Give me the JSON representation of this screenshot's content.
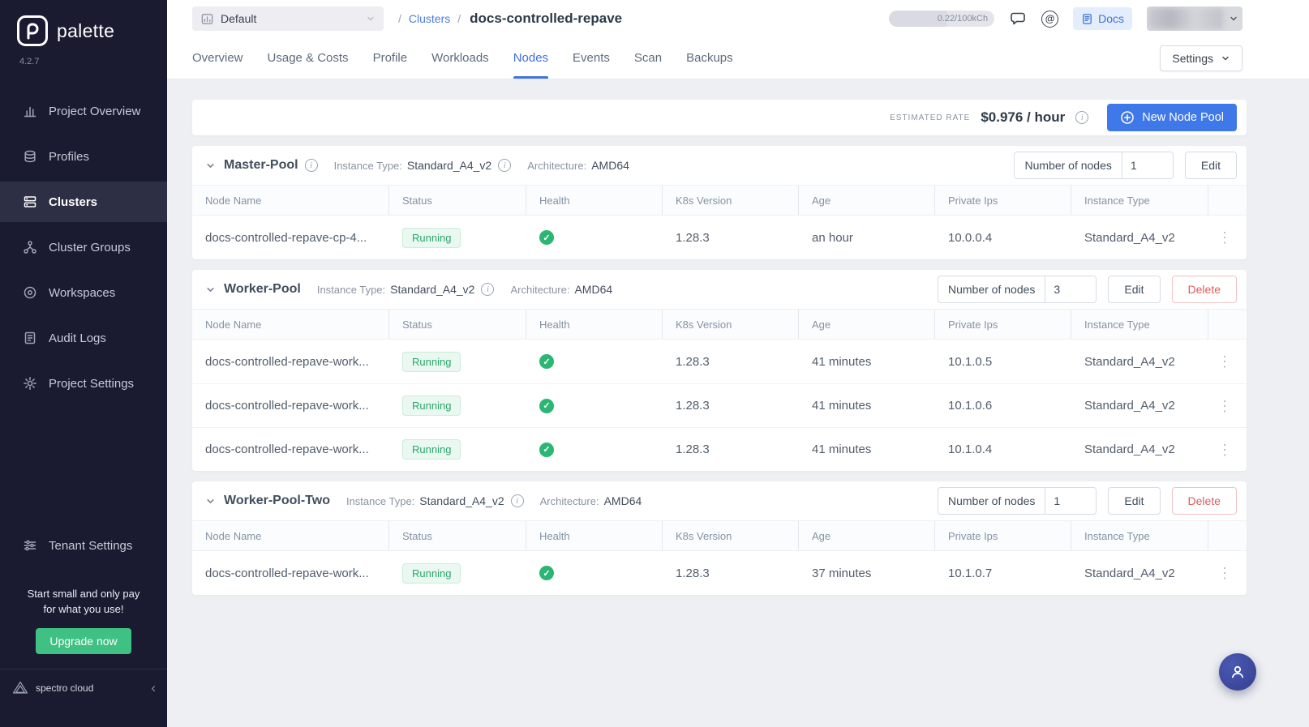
{
  "icons": {
    "info_glyph": "i",
    "kebab_glyph": "⋮",
    "check_glyph": "✓",
    "at_glyph": "@",
    "collapse_glyph": "‹"
  },
  "sidebar": {
    "brand": "palette",
    "version": "4.2.7",
    "items": [
      {
        "label": "Project Overview"
      },
      {
        "label": "Profiles"
      },
      {
        "label": "Clusters"
      },
      {
        "label": "Cluster Groups"
      },
      {
        "label": "Workspaces"
      },
      {
        "label": "Audit Logs"
      },
      {
        "label": "Project Settings"
      }
    ],
    "tenant_settings_label": "Tenant Settings",
    "promo_line1": "Start small and only pay",
    "promo_line2": "for what you use!",
    "upgrade_button": "Upgrade now",
    "footer_brand": "spectro cloud"
  },
  "header": {
    "project_selector": "Default",
    "breadcrumb_separator": "/",
    "breadcrumb_link": "Clusters",
    "page_title": "docs-controlled-repave",
    "usage_pill": "0.22/100kCh",
    "docs_button": "Docs"
  },
  "tabs": {
    "items": [
      {
        "label": "Overview"
      },
      {
        "label": "Usage & Costs"
      },
      {
        "label": "Profile"
      },
      {
        "label": "Workloads"
      },
      {
        "label": "Nodes"
      },
      {
        "label": "Events"
      },
      {
        "label": "Scan"
      },
      {
        "label": "Backups"
      }
    ],
    "settings_button": "Settings"
  },
  "rate_bar": {
    "label": "ESTIMATED RATE",
    "value": "$0.976 / hour",
    "new_pool_button": "New Node Pool"
  },
  "table": {
    "headers": [
      "Node Name",
      "Status",
      "Health",
      "K8s Version",
      "Age",
      "Private Ips",
      "Instance Type"
    ]
  },
  "pools": [
    {
      "name": "Master-Pool",
      "instance_type_label": "Instance Type:",
      "instance_type": "Standard_A4_v2",
      "architecture_label": "Architecture:",
      "architecture": "AMD64",
      "nodes_label": "Number of nodes",
      "nodes_count": "1",
      "edit_button": "Edit",
      "rows": [
        {
          "name": "docs-controlled-repave-cp-4...",
          "status": "Running",
          "k8s_version": "1.28.3",
          "age": "an hour",
          "private_ip": "10.0.0.4",
          "instance_type": "Standard_A4_v2"
        }
      ]
    },
    {
      "name": "Worker-Pool",
      "instance_type_label": "Instance Type:",
      "instance_type": "Standard_A4_v2",
      "architecture_label": "Architecture:",
      "architecture": "AMD64",
      "nodes_label": "Number of nodes",
      "nodes_count": "3",
      "edit_button": "Edit",
      "delete_button": "Delete",
      "rows": [
        {
          "name": "docs-controlled-repave-work...",
          "status": "Running",
          "k8s_version": "1.28.3",
          "age": "41 minutes",
          "private_ip": "10.1.0.5",
          "instance_type": "Standard_A4_v2"
        },
        {
          "name": "docs-controlled-repave-work...",
          "status": "Running",
          "k8s_version": "1.28.3",
          "age": "41 minutes",
          "private_ip": "10.1.0.6",
          "instance_type": "Standard_A4_v2"
        },
        {
          "name": "docs-controlled-repave-work...",
          "status": "Running",
          "k8s_version": "1.28.3",
          "age": "41 minutes",
          "private_ip": "10.1.0.4",
          "instance_type": "Standard_A4_v2"
        }
      ]
    },
    {
      "name": "Worker-Pool-Two",
      "instance_type_label": "Instance Type:",
      "instance_type": "Standard_A4_v2",
      "architecture_label": "Architecture:",
      "architecture": "AMD64",
      "nodes_label": "Number of nodes",
      "nodes_count": "1",
      "edit_button": "Edit",
      "delete_button": "Delete",
      "rows": [
        {
          "name": "docs-controlled-repave-work...",
          "status": "Running",
          "k8s_version": "1.28.3",
          "age": "37 minutes",
          "private_ip": "10.1.0.7",
          "instance_type": "Standard_A4_v2"
        }
      ]
    }
  ]
}
